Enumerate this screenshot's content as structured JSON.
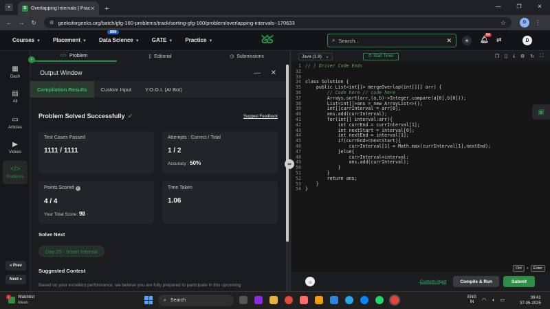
{
  "browser": {
    "tab_title": "Overlapping Intervals | Practice",
    "url": "geeksforgeeks.org/batch/gfg-160-problems/track/sorting-gfg-160/problem/overlapping-intervals--170633",
    "profile_initial": "D"
  },
  "header": {
    "nav": [
      "Courses",
      "Placement",
      "Data Science",
      "GATE",
      "Practice"
    ],
    "ibm_badge": "IBM",
    "search_placeholder": "Search...",
    "notification_count": "64",
    "avatar_initial": "D"
  },
  "sidebar": {
    "items": [
      {
        "label": "Dash",
        "icon": "dashboard-icon"
      },
      {
        "label": "All",
        "icon": "all-icon"
      },
      {
        "label": "Articles",
        "icon": "article-icon"
      },
      {
        "label": "Videos",
        "icon": "video-icon"
      },
      {
        "label": "Problems",
        "icon": "code-icon"
      }
    ],
    "prev_label": "« Prev",
    "next_label": "Next »"
  },
  "problem_tabs": [
    "Problem",
    "Editorial",
    "Submissions"
  ],
  "output": {
    "title": "Output Window",
    "tabs": [
      "Compilation Results",
      "Custom Input",
      "Y.O.G.I. (AI Bot)"
    ],
    "status": "Problem Solved Successfully",
    "suggest_feedback": "Suggest Feedback",
    "test_cases_label": "Test Cases Passed",
    "test_cases_value": "1111 / 1111",
    "attempts_label": "Attempts : Correct / Total",
    "attempts_value": "1 / 2",
    "accuracy_label": "Accuracy :",
    "accuracy_value": "50%",
    "points_label": "Points Scored",
    "points_value": "4 / 4",
    "total_score_label": "Your Total Score:",
    "total_score_value": "98",
    "time_label": "Time Taken",
    "time_value": "1.06",
    "solve_next_heading": "Solve Next",
    "solve_next_item": "Day 25 - Insert Interval",
    "contest_heading": "Suggested Contest",
    "contest_text": "Based on your excellent performance, we believe you are fully prepared to participate in this upcoming"
  },
  "editor": {
    "language": "Java (1.8)",
    "timer_label": "Start Timer",
    "lines": [
      {
        "n": "1",
        "t": "// } Driver Code Ends",
        "cmt": true
      },
      {
        "n": "32",
        "t": "",
        "cmt": false
      },
      {
        "n": "33",
        "t": "",
        "cmt": false
      },
      {
        "n": "34",
        "t": "class Solution {",
        "cmt": false
      },
      {
        "n": "35",
        "t": "    public List<int[]> mergeOverlap(int[][] arr) {",
        "cmt": false
      },
      {
        "n": "36",
        "t": "        // Code here // code here",
        "cmt": true
      },
      {
        "n": "37",
        "t": "        Arrays.sort(arr,(a,b)->Integer.compare(a[0],b[0]));",
        "cmt": false
      },
      {
        "n": "38",
        "t": "        List<int[]>ans = new ArrayList<>();",
        "cmt": false
      },
      {
        "n": "39",
        "t": "        int[]currInterval = arr[0];",
        "cmt": false
      },
      {
        "n": "40",
        "t": "        ans.add(currInterval);",
        "cmt": false
      },
      {
        "n": "41",
        "t": "        for(int[] interval:arr){",
        "cmt": false
      },
      {
        "n": "42",
        "t": "            int currEnd = currInterval[1];",
        "cmt": false
      },
      {
        "n": "43",
        "t": "            int nextStart = interval[0];",
        "cmt": false
      },
      {
        "n": "44",
        "t": "            int nextEnd = interval[1];",
        "cmt": false
      },
      {
        "n": "45",
        "t": "            if(currEnd>=nextStart){",
        "cmt": false
      },
      {
        "n": "46",
        "t": "                currInterval[1] = Math.max(currInterval[1],nextEnd);",
        "cmt": false
      },
      {
        "n": "47",
        "t": "            }else{",
        "cmt": false
      },
      {
        "n": "48",
        "t": "                currInterval=interval;",
        "cmt": false
      },
      {
        "n": "49",
        "t": "                ans.add(currInterval);",
        "cmt": false
      },
      {
        "n": "50",
        "t": "            }",
        "cmt": false
      },
      {
        "n": "51",
        "t": "        }",
        "cmt": false
      },
      {
        "n": "52",
        "t": "        return ans;",
        "cmt": false
      },
      {
        "n": "53",
        "t": "    }",
        "cmt": false
      },
      {
        "n": "54",
        "t": "}",
        "cmt": false
      }
    ],
    "kbd_ctrl": "Ctrl",
    "kbd_plus": "+",
    "kbd_enter": "Enter",
    "custom_input": "Custom Input",
    "compile_label": "Compile & Run",
    "submit_label": "Submit"
  },
  "taskbar": {
    "weather_title": "Watchlist",
    "weather_sub": "Ideas",
    "weather_badge": "1",
    "search_label": "Search",
    "lang_top": "ENG",
    "lang_bottom": "IN",
    "time": "09:41",
    "date": "07-05-2025"
  }
}
